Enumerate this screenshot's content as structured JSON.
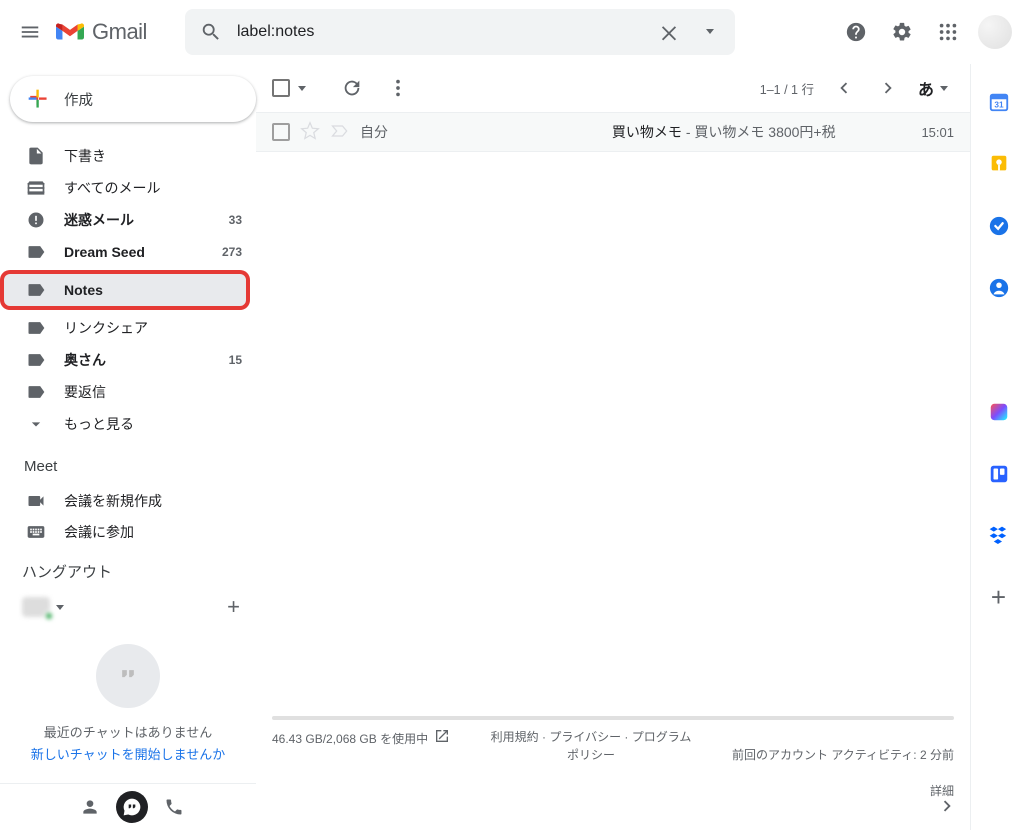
{
  "header": {
    "product": "Gmail",
    "search_value": "label:notes"
  },
  "compose_label": "作成",
  "sidebar": {
    "items": [
      {
        "icon": "draft",
        "label": "下書き",
        "count": "",
        "bold": false
      },
      {
        "icon": "stack",
        "label": "すべてのメール",
        "count": "",
        "bold": false
      },
      {
        "icon": "spam",
        "label": "迷惑メール",
        "count": "33",
        "bold": true
      },
      {
        "icon": "label",
        "label": "Dream Seed",
        "count": "273",
        "bold": true
      },
      {
        "icon": "label",
        "label": "Notes",
        "count": "",
        "bold": true,
        "selected": true,
        "highlight": true
      },
      {
        "icon": "label",
        "label": "リンクシェア",
        "count": "",
        "bold": false
      },
      {
        "icon": "label",
        "label": "奥さん",
        "count": "15",
        "bold": true
      },
      {
        "icon": "label",
        "label": "要返信",
        "count": "",
        "bold": false
      },
      {
        "icon": "expand",
        "label": "もっと見る",
        "count": "",
        "bold": false
      }
    ]
  },
  "meet": {
    "header": "Meet",
    "new": "会議を新規作成",
    "join": "会議に参加"
  },
  "hangouts": {
    "header": "ハングアウト",
    "empty_line1": "最近のチャットはありません",
    "empty_line2": "新しいチャットを開始しませんか"
  },
  "toolbar": {
    "pager": "1–1 / 1 行",
    "lang": "あ"
  },
  "messages": [
    {
      "sender": "自分",
      "subject": "買い物メモ",
      "snippet": "買い物メモ 3800円+税",
      "time": "15:01"
    }
  ],
  "footer": {
    "storage": "46.43 GB/2,068 GB を使用中",
    "links": "利用規約 · プライバシー · プログラム ポリシー",
    "activity_line1": "前回のアカウント アクティビティ: 2 分前",
    "activity_line2": "詳細"
  }
}
